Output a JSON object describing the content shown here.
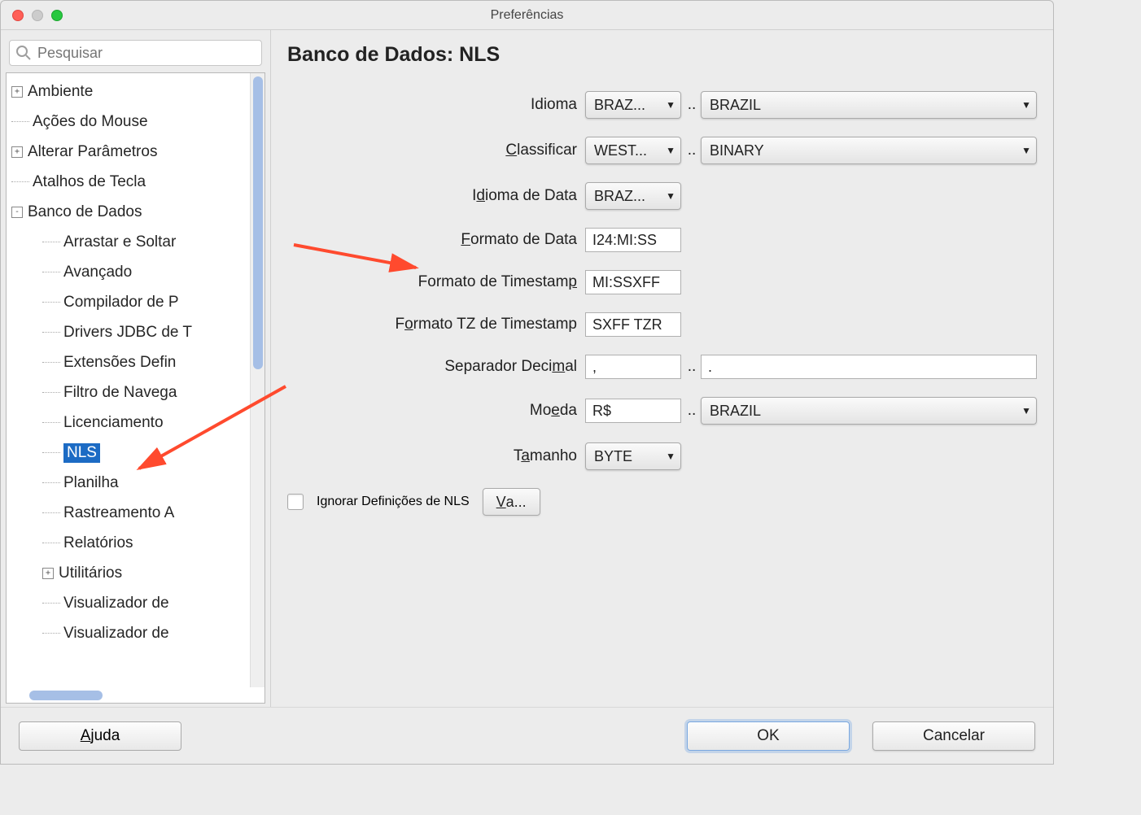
{
  "window": {
    "title": "Preferências"
  },
  "search": {
    "placeholder": "Pesquisar"
  },
  "tree": {
    "items": [
      {
        "label": "Ambiente",
        "toggle": "+",
        "level": 0
      },
      {
        "label": "Ações do Mouse",
        "toggle": "",
        "level": 0
      },
      {
        "label": "Alterar Parâmetros",
        "toggle": "+",
        "level": 0
      },
      {
        "label": "Atalhos de Tecla",
        "toggle": "",
        "level": 0
      },
      {
        "label": "Banco de Dados",
        "toggle": "-",
        "level": 0
      },
      {
        "label": "Arrastar e Soltar",
        "toggle": "",
        "level": 1
      },
      {
        "label": "Avançado",
        "toggle": "",
        "level": 1
      },
      {
        "label": "Compilador de P",
        "toggle": "",
        "level": 1
      },
      {
        "label": "Drivers JDBC de T",
        "toggle": "",
        "level": 1
      },
      {
        "label": "Extensões Defin",
        "toggle": "",
        "level": 1
      },
      {
        "label": "Filtro de Navega",
        "toggle": "",
        "level": 1
      },
      {
        "label": "Licenciamento",
        "toggle": "",
        "level": 1
      },
      {
        "label": "NLS",
        "toggle": "",
        "level": 1,
        "selected": true
      },
      {
        "label": "Planilha",
        "toggle": "",
        "level": 1
      },
      {
        "label": "Rastreamento A",
        "toggle": "",
        "level": 1
      },
      {
        "label": "Relatórios",
        "toggle": "",
        "level": 1
      },
      {
        "label": "Utilitários",
        "toggle": "+",
        "level": 1
      },
      {
        "label": "Visualizador de",
        "toggle": "",
        "level": 1
      },
      {
        "label": "Visualizador de",
        "toggle": "",
        "level": 1
      }
    ]
  },
  "page": {
    "heading": "Banco de Dados: NLS",
    "labels": {
      "idioma": "Idioma",
      "classificar": "Classificar",
      "idioma_data": "Idioma de Data",
      "formato_data": "Formato de Data",
      "formato_ts": "Formato de Timestamp",
      "formato_tz": "Formato TZ de Timestamp",
      "sep_decimal": "Separador Decimal",
      "moeda": "Moeda",
      "tamanho": "Tamanho",
      "ignore": "Ignorar Definições de NLS",
      "va": "Va..."
    },
    "values": {
      "idioma_combo": "BRAZ...",
      "idioma_territory": "BRAZIL",
      "classificar_combo": "WEST...",
      "classificar_sort": "BINARY",
      "idioma_data_combo": "BRAZ...",
      "formato_data": "I24:MI:SS",
      "formato_ts": "MI:SSXFF",
      "formato_tz": "SXFF TZR",
      "sep_decimal_a": ",",
      "sep_decimal_b": ".",
      "moeda_symbol": "R$",
      "moeda_territory": "BRAZIL",
      "tamanho": "BYTE"
    }
  },
  "footer": {
    "help": "Ajuda",
    "ok": "OK",
    "cancel": "Cancelar"
  }
}
